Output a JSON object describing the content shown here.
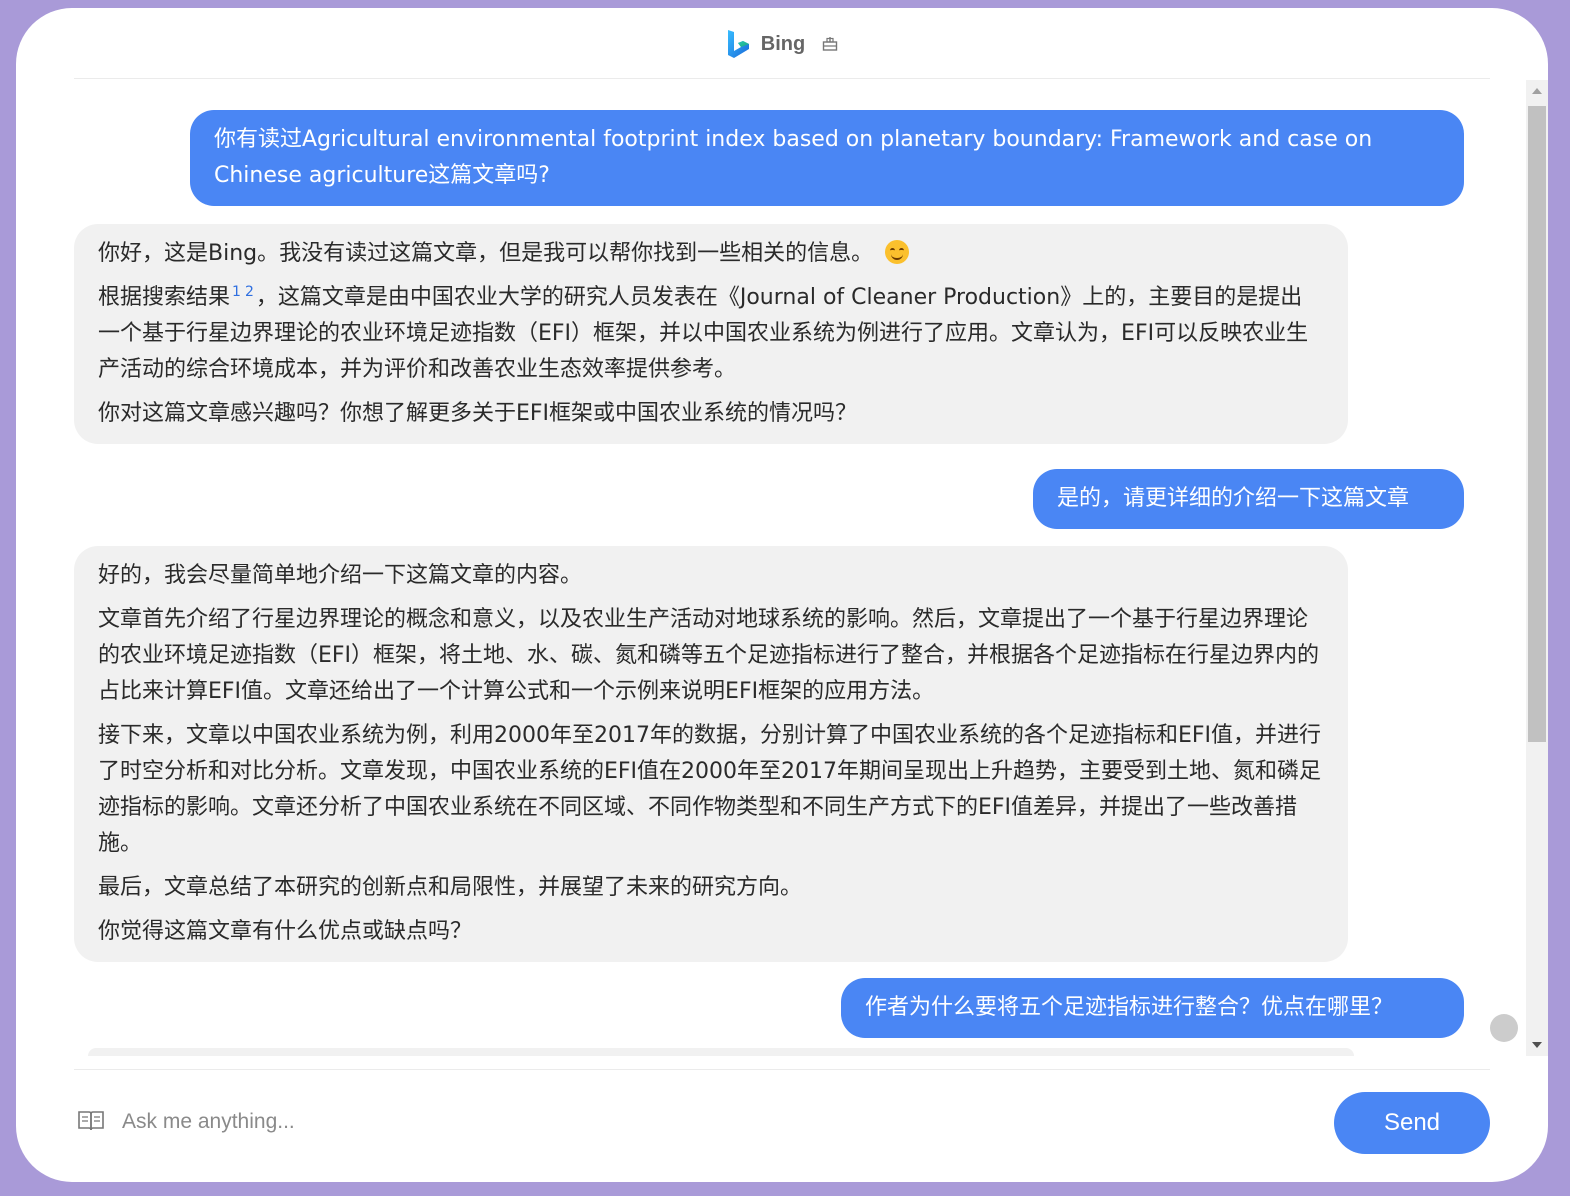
{
  "header": {
    "title": "Bing",
    "logo_icon": "bing-logo-icon",
    "badge_icon": "chat-mode-icon"
  },
  "messages": [
    {
      "role": "user",
      "text": "你有读过Agricultural environmental footprint index based on planetary boundary: Framework and case on Chinese agriculture这篇文章吗?"
    },
    {
      "role": "bot",
      "p1": "你好，这是Bing。我没有读过这篇文章，但是我可以帮你找到一些相关的信息。",
      "p2_prefix": "根据搜索结果",
      "ref1": "1",
      "ref2": "2",
      "p2_text": "，这篇文章是由中国农业大学的研究人员发表在《Journal of Cleaner Production》上的，主要目的是提出一个基于行星边界理论的农业环境足迹指数（EFI）框架，并以中国农业系统为例进行了应用。文章认为，EFI可以反映农业生产活动的综合环境成本，并为评价和改善农业生态效率提供参考。",
      "p3": "你对这篇文章感兴趣吗？你想了解更多关于EFI框架或中国农业系统的情况吗？"
    },
    {
      "role": "user",
      "text": "是的，请更详细的介绍一下这篇文章"
    },
    {
      "role": "bot",
      "p1": "好的，我会尽量简单地介绍一下这篇文章的内容。",
      "p2": "文章首先介绍了行星边界理论的概念和意义，以及农业生产活动对地球系统的影响。然后，文章提出了一个基于行星边界理论的农业环境足迹指数（EFI）框架，将土地、水、碳、氮和磷等五个足迹指标进行了整合，并根据各个足迹指标在行星边界内的占比来计算EFI值。文章还给出了一个计算公式和一个示例来说明EFI框架的应用方法。",
      "p3": "接下来，文章以中国农业系统为例，利用2000年至2017年的数据，分别计算了中国农业系统的各个足迹指标和EFI值，并进行了时空分析和对比分析。文章发现，中国农业系统的EFI值在2000年至2017年期间呈现出上升趋势，主要受到土地、氮和磷足迹指标的影响。文章还分析了中国农业系统在不同区域、不同作物类型和不同生产方式下的EFI值差异，并提出了一些改善措施。",
      "p4": "最后，文章总结了本研究的创新点和局限性，并展望了未来的研究方向。",
      "p5": "你觉得这篇文章有什么优点或缺点吗？"
    },
    {
      "role": "user",
      "text": "作者为什么要将五个足迹指标进行整合？优点在哪里？"
    }
  ],
  "composer": {
    "placeholder": "Ask me anything...",
    "send_label": "Send",
    "icon": "book-icon"
  },
  "colors": {
    "user_bubble": "#4a86f4",
    "bot_bubble": "#f1f1f1",
    "frame": "#a99ad8"
  }
}
